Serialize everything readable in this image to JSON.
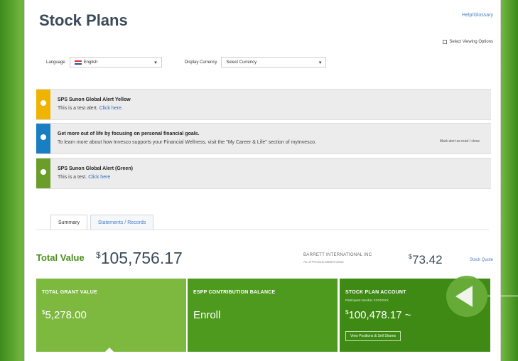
{
  "header": {
    "title": "Stock Plans",
    "help_link": "Help/Glossary",
    "view_options": "Select Viewing Options"
  },
  "selectors": {
    "language_label": "Language",
    "language_value": "English",
    "currency_label": "Display Currency",
    "currency_value": "Select Currency"
  },
  "alerts": [
    {
      "color": "#f0b400",
      "title": "SPS Sunon Global Alert Yellow",
      "body": "This is a test alert.",
      "link": "Click here."
    },
    {
      "color": "#1a7ec2",
      "title": "Get more out of life by focusing on personal financial goals.",
      "body": "To learn more about how Invesco supports your Financial Wellness, visit the \"My Career & Life\" section of myInvesco.",
      "link": "",
      "side": "Mark alert as read / close"
    },
    {
      "color": "#6a9d2a",
      "title": "SPS Sunon Global Alert (Green)",
      "body": "This is a test.",
      "link": "Click here"
    }
  ],
  "tabs": [
    {
      "label": "Summary",
      "active": true
    },
    {
      "label": "Statements / Records",
      "active": false
    }
  ],
  "total": {
    "label": "Total Value",
    "currency_symbol": "$",
    "value": "105,756.17"
  },
  "stock_price": {
    "company": "BARRETT INTERNATIONAL INC",
    "subtext": "As of Previous Market Close",
    "currency_symbol": "$",
    "value": "73.42",
    "quote_link": "Stock Quote"
  },
  "cards": [
    {
      "title": "TOTAL GRANT VALUE",
      "sub": "",
      "currency_symbol": "$",
      "value": "5,278.00",
      "color": "#7cb93e",
      "button": ""
    },
    {
      "title": "ESPP CONTRIBUTION BALANCE",
      "sub": "",
      "currency_symbol": "",
      "value": "Enroll",
      "color": "#4e9a1e",
      "button": ""
    },
    {
      "title": "STOCK PLAN ACCOUNT",
      "sub": "Participant Number XXXXXXX",
      "currency_symbol": "$",
      "value": "100,478.17 ~",
      "color": "#3f8a14",
      "button": "View Positions & Sell Shares"
    }
  ]
}
